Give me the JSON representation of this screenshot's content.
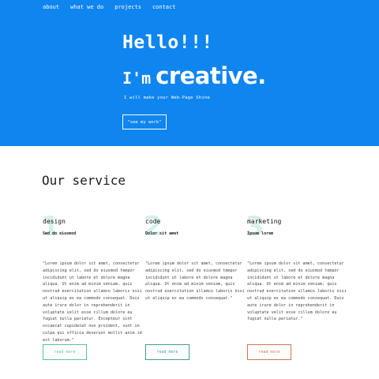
{
  "nav": {
    "items": [
      "about",
      "what we do",
      "projects",
      "contact"
    ]
  },
  "hero": {
    "hello": "Hello!!!",
    "im": "I'm",
    "creative": "creative.",
    "tagline": "I will make your Web-Page Shine",
    "cta": "\"see my work\""
  },
  "services": {
    "title": "Our service",
    "cards": [
      {
        "number": "1",
        "title": "design",
        "subtitle": "Sed do eiusmod",
        "body": "\"Lorem ipsum dolor sit amet, consectetur adipiscing elit, sed do eiusmod tempor incididunt ut labore et dolore magna aliqua. Ut enim ad minim veniam, quis nostrud exercitation ullamco laboris nisi ut aliquip ex ea commodo consequat. Duis aute irure dolor in reprehenderit in voluptate velit esse cillum dolore eu fugiat nulla pariatur. Excepteur sint occaecat cupidatat non proident, sunt in culpa qui officia deserunt mollit anim id est laborum.\"",
        "button": "read more",
        "accent_color": "#5dbf9a",
        "number_color": "#d6f1e6"
      },
      {
        "number": "2",
        "title": "code",
        "subtitle": "Dolor sit amet",
        "body": "\"Lorem ipsum dolor sit amet, consectetur adipiscing elit, sed do eiusmod tempor incididunt ut labore et dolore magna aliqua. Ut enim ad minim veniam, quis nostrud exercitation ullamco laboris nisi ut aliquip ex ea commodo consequat.\"",
        "button": "read more",
        "accent_color": "#3f9a9a",
        "number_color": "#d4eeee"
      },
      {
        "number": "3",
        "title": "marketing",
        "subtitle": "Ipsum lorem",
        "body": "\"Lorem ipsum dolor sit amet, consectetur adipiscing elit, sed do eiusmod tempor incididunt ut labore et dolore magna aliqua. Ut enim ad minim veniam, quis nostrud exercitation ullamco laboris nisi ut aliquip ex ea commodo consequat. Duis aute irure dolor in reprehenderit in voluptate velit esse cillum dolore eu fugiat nulla pariatur.\"",
        "button": "read more",
        "accent_color": "#c9794f",
        "number_color": "#d8eeea"
      }
    ]
  },
  "colors": {
    "hero_bg": "#0f85ef"
  }
}
